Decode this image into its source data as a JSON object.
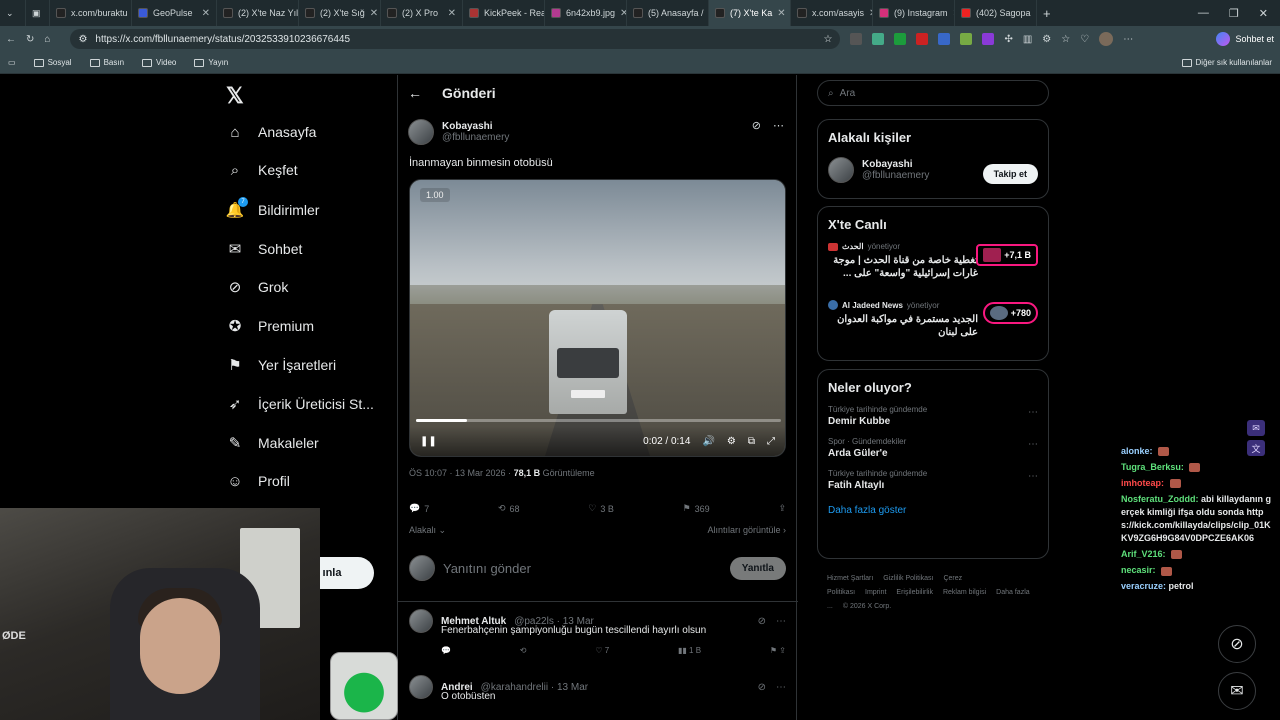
{
  "browser": {
    "tabs": [
      {
        "label": "x.com/buraktu",
        "color": "#222"
      },
      {
        "label": "GeoPulse",
        "color": "#3a5ad8"
      },
      {
        "label": "(2) X'te Naz Yıl",
        "color": "#222"
      },
      {
        "label": "(2) X'te Sığ",
        "color": "#222"
      },
      {
        "label": "(2) X Pro",
        "color": "#222"
      },
      {
        "label": "KickPeek - Rea",
        "color": "#a33"
      },
      {
        "label": "6n42xb9.jpg",
        "color": "#b33a90"
      },
      {
        "label": "(5) Anasayfa /",
        "color": "#222"
      },
      {
        "label": "(7) X'te Ka",
        "color": "#222"
      },
      {
        "label": "x.com/asayis",
        "color": "#222"
      },
      {
        "label": "(9) Instagram",
        "color": "#d6307a"
      },
      {
        "label": "(402) Sagopa",
        "color": "#e22"
      }
    ],
    "url": "https://x.com/fbllunaemery/status/2032533910236676445",
    "chat_label": "Sohbet et",
    "bookmarks": [
      "Sosyal",
      "Basın",
      "Video",
      "Yayın"
    ],
    "bookmarks_other": "Diğer sık kullanılanlar"
  },
  "nav": {
    "items": [
      {
        "label": "Anasayfa",
        "icon": "⌂"
      },
      {
        "label": "Keşfet",
        "icon": "⌕"
      },
      {
        "label": "Bildirimler",
        "icon": "🔔"
      },
      {
        "label": "Sohbet",
        "icon": "✉"
      },
      {
        "label": "Grok",
        "icon": "⊘"
      },
      {
        "label": "Premium",
        "icon": "✪"
      },
      {
        "label": "Yer İşaretleri",
        "icon": "⚑"
      },
      {
        "label": "İçerik Üreticisi St...",
        "icon": "➶"
      },
      {
        "label": "Makaleler",
        "icon": "✎"
      },
      {
        "label": "Profil",
        "icon": "☺"
      }
    ],
    "notif_badge": "7",
    "post_button_partial": "ınla"
  },
  "post": {
    "header": "Gönderi",
    "author_name": "Kobayashi",
    "author_handle": "@fbllunaemery",
    "text": "İnanmayan binmesin otobüsü",
    "video": {
      "speed": "1.00",
      "time": "0:02 / 0:14",
      "progress_fraction": 0.14
    },
    "time": "ÖS 10:07 · 13 Mar 2026 · ",
    "views": "78,1 B",
    "views_label": " Görüntüleme",
    "stats": {
      "replies": "7",
      "reposts": "68",
      "likes": "3 B",
      "bookmarks": "369"
    },
    "related": "Alakalı",
    "quotes": "Alıntıları görüntüle",
    "reply_placeholder": "Yanıtını gönder",
    "reply_button": "Yanıtla"
  },
  "comments": [
    {
      "name": "Mehmet Altuk",
      "handle": "@pa22ls · 13 Mar",
      "text": "Fenerbahçenin şampiyonluğu bugün tescillendi hayırlı olsun",
      "likes": "7",
      "views": "1 B"
    },
    {
      "name": "Andrei",
      "handle": "@karahandrelii · 13 Mar",
      "text": "O otobüsten"
    }
  ],
  "sidebar": {
    "search_placeholder": "Ara",
    "related_people_title": "Alakalı kişiler",
    "person_name": "Kobayashi",
    "person_handle": "@fbllunaemery",
    "follow_label": "Takip et",
    "live_title": "X'te Canlı",
    "live_items": [
      {
        "source": "الحدث",
        "status": "yönetiyor",
        "title": "تغطية خاصة من قناة الحدث | موجة غارات إسرائيلية \"واسعة\" على ...",
        "count": "+7,1 B"
      },
      {
        "source": "Al Jadeed News",
        "status": "yönetiyor",
        "title": "الجديد مستمرة في مواكبة العدوان على لبنان",
        "count": "+780"
      }
    ],
    "trends_title": "Neler oluyor?",
    "trends": [
      {
        "category": "Türkiye tarihinde gündemde",
        "name": "Demir Kubbe"
      },
      {
        "category": "Spor · Gündemdekiler",
        "name": "Arda Güler'e"
      },
      {
        "category": "Türkiye tarihinde gündemde",
        "name": "Fatih Altaylı"
      }
    ],
    "show_more": "Daha fazla göster",
    "footer": [
      "Hizmet Şartları",
      "Gizlilik Politikası",
      "Çerez Politikası",
      "Imprint",
      "Erişilebilirlik",
      "Reklam bilgisi",
      "Daha fazla ...",
      "© 2026 X Corp."
    ]
  },
  "stream_chat": [
    {
      "user": "alonke:",
      "msg": "",
      "color": "#9ad0ff"
    },
    {
      "user": "Tugra_Berksu:",
      "msg": "",
      "color": "#5ee07b"
    },
    {
      "user": "imhoteap:",
      "msg": "",
      "color": "#ff4a4a"
    },
    {
      "user": "Nosferatu_Zoddd:",
      "msg": "abi killaydanın gerçek kimliği ifşa oldu sonda https://kick.com/killayda/clips/clip_01KKV9ZG6H9G84V0DPCZE6AK06",
      "color": "#5ee07b"
    },
    {
      "user": "Arif_V216:",
      "msg": "",
      "color": "#5ee07b"
    },
    {
      "user": "necasir:",
      "msg": "",
      "color": "#5ee07b"
    },
    {
      "user": "veracruze:",
      "msg": "petrol",
      "color": "#9ad0ff"
    }
  ],
  "webcam_text": "ØDE"
}
